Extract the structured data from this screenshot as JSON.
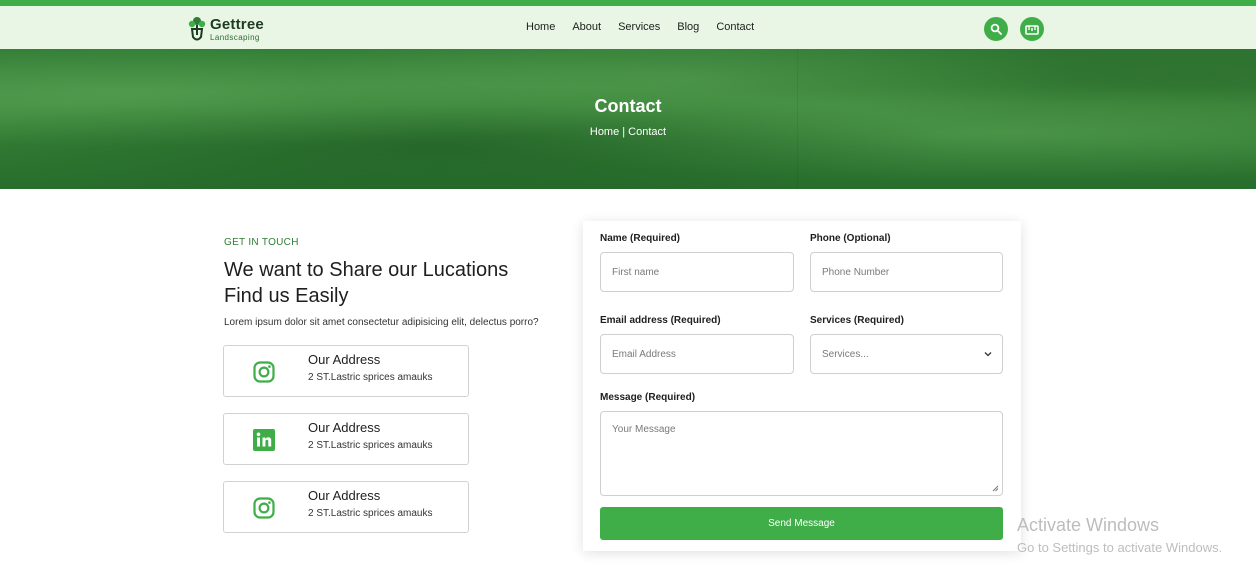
{
  "brand": {
    "name": "Gettree",
    "tagline": "Landscaping"
  },
  "nav": {
    "items": [
      "Home",
      "About",
      "Services",
      "Blog",
      "Contact"
    ]
  },
  "header_icons": {
    "search": "search-icon",
    "cart": "cart-icon"
  },
  "hero": {
    "title": "Contact",
    "breadcrumb": "Home | Contact"
  },
  "intro": {
    "eyebrow": "GET IN TOUCH",
    "headline_line1": "We want to Share our Lucations",
    "headline_line2": "Find us Easily",
    "lead": "Lorem ipsum dolor sit amet consectetur adipisicing elit, delectus porro?"
  },
  "cards": [
    {
      "icon": "instagram-icon",
      "title": "Our Address",
      "subtitle": "2 ST.Lastric sprices amauks"
    },
    {
      "icon": "linkedin-icon",
      "title": "Our Address",
      "subtitle": "2 ST.Lastric sprices amauks"
    },
    {
      "icon": "instagram-icon",
      "title": "Our Address",
      "subtitle": "2 ST.Lastric sprices amauks"
    }
  ],
  "form": {
    "name_label": "Name (Required)",
    "name_placeholder": "First name",
    "phone_label": "Phone (Optional)",
    "phone_placeholder": "Phone Number",
    "email_label": "Email address (Required)",
    "email_placeholder": "Email Address",
    "services_label": "Services (Required)",
    "services_value": "Services...",
    "message_label": "Message (Required)",
    "message_placeholder": "Your Message",
    "submit_label": "Send Message"
  },
  "watermark": {
    "line1": "Activate Windows",
    "line2": "Go to Settings to activate Windows."
  },
  "colors": {
    "accent": "#3fae49",
    "nav_bg": "#e9f6e5",
    "brand_dark": "#1d3b21"
  }
}
